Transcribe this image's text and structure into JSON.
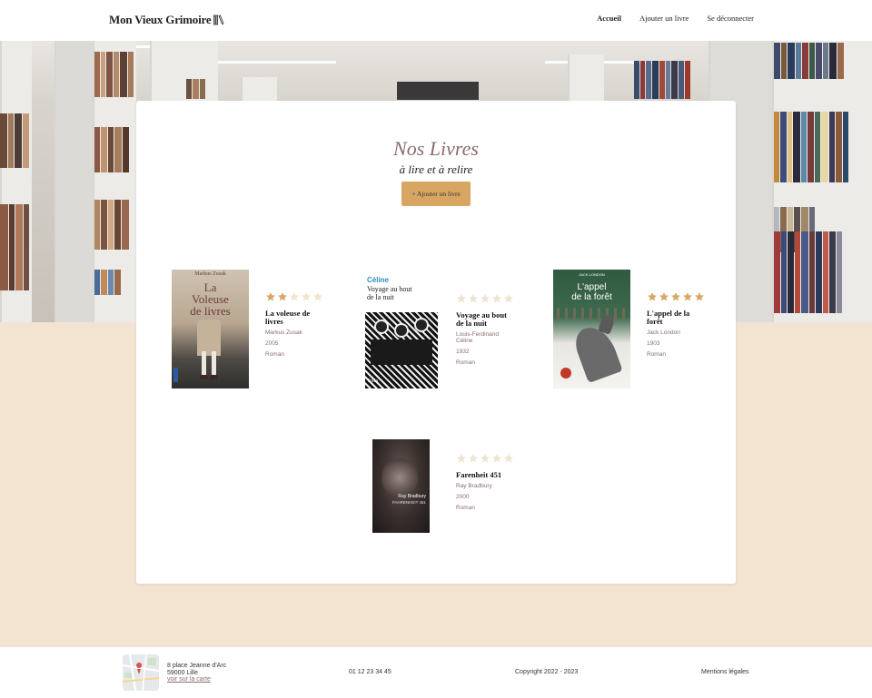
{
  "header": {
    "logo_text": "Mon Vieux Grimoire",
    "nav": [
      "Accueil",
      "Ajouter un livre",
      "Se déconnecter"
    ]
  },
  "main": {
    "title": "Nos Livres",
    "subtitle": "à lire et à relire",
    "add_button": "+ Ajouter un livre"
  },
  "books": [
    {
      "title": "La voleuse de livres",
      "author": "Markus Zusak",
      "year": "2005",
      "genre": "Roman",
      "rating": 2,
      "cover_text": [
        "Markus Zusak",
        "La",
        "Voleuse",
        "de livres"
      ]
    },
    {
      "title": "Voyage au bout de la nuit",
      "author": "Louis-Ferdinand Céline",
      "year": "1932",
      "genre": "Roman",
      "rating": 0,
      "cover_text": [
        "Céline",
        "Voyage au bout",
        "de la nuit",
        "folio"
      ]
    },
    {
      "title": "L'appel de la forêt",
      "author": "Jack London",
      "year": "1903",
      "genre": "Roman",
      "rating": 5,
      "cover_text": [
        "JACK LONDON",
        "L'appel",
        "de la forêt"
      ]
    },
    {
      "title": "Farenheit 451",
      "author": "Ray Bradbury",
      "year": "2000",
      "genre": "Roman",
      "rating": 0,
      "cover_text": [
        "Ray Bradbury",
        "FAHRENHEIT 451"
      ]
    }
  ],
  "footer": {
    "address_line1": "8 place Jeanne d'Arc",
    "address_line2": "59000 Lille",
    "map_link": "voir sur la carte",
    "phone": "01 12 23 34 45",
    "copyright": "Copyright 2022 - 2023",
    "legal": "Mentions légales"
  },
  "colors": {
    "accent": "#d8a662",
    "star_filled": "#d8a662",
    "star_empty": "#f0e3cf",
    "muted_text": "#8a6d6d",
    "page_bg": "#f2e4d0"
  }
}
